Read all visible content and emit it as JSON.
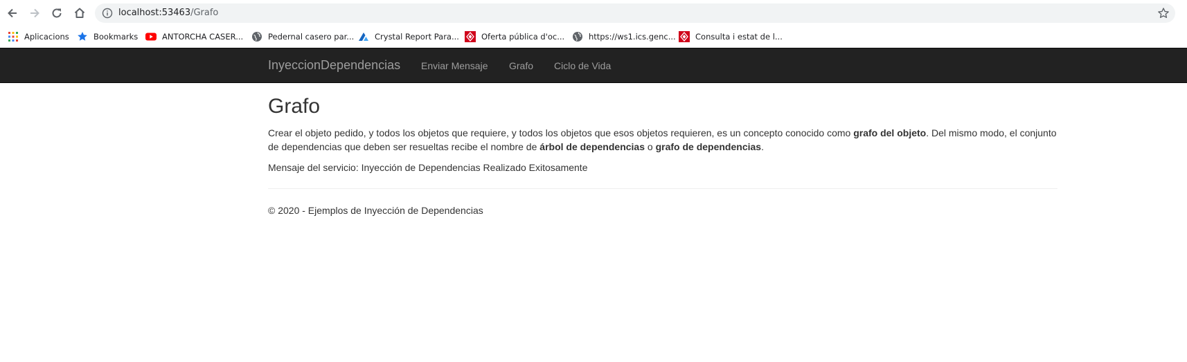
{
  "browser": {
    "url_host": "localhost:53463",
    "url_path": "/Grafo",
    "bookmarks": [
      {
        "label": "Aplicacions",
        "icon": "apps-grid-icon"
      },
      {
        "label": "Bookmarks",
        "icon": "star-icon"
      },
      {
        "label": "ANTORCHA CASER...",
        "icon": "youtube-icon"
      },
      {
        "label": "Pedernal casero par...",
        "icon": "globe-icon"
      },
      {
        "label": "Crystal Report Para...",
        "icon": "crystal-report-icon"
      },
      {
        "label": "Oferta pública d'oc...",
        "icon": "generalitat-icon"
      },
      {
        "label": "https://ws1.ics.genc...",
        "icon": "globe-icon"
      },
      {
        "label": "Consulta i estat de l...",
        "icon": "generalitat-icon"
      }
    ]
  },
  "navbar": {
    "brand": "InyeccionDependencias",
    "links": [
      "Enviar Mensaje",
      "Grafo",
      "Ciclo de Vida"
    ]
  },
  "main": {
    "title": "Grafo",
    "paragraph": {
      "part1": "Crear el objeto pedido, y todos los objetos que requiere, y todos los objetos que esos objetos requieren, es un concepto conocido como ",
      "bold1": "grafo del objeto",
      "part2": ". Del mismo modo, el conjunto de dependencias que deben ser resueltas recibe el nombre de ",
      "bold2": "árbol de dependencias",
      "part3": " o ",
      "bold3": "grafo de dependencias",
      "part4": "."
    },
    "service_message": "Mensaje del servicio: Inyección de Dependencias Realizado Exitosamente"
  },
  "footer": {
    "text": "© 2020 - Ejemplos de Inyección de Dependencias"
  },
  "colors": {
    "navbar_bg": "#222222",
    "navbar_text": "#9d9d9d",
    "body_text": "#333333",
    "omnibox_bg": "#f1f3f4"
  }
}
